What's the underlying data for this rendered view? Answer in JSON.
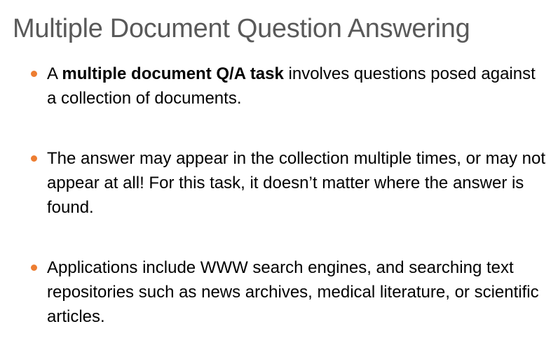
{
  "slide": {
    "title": "Multiple Document Question Answering",
    "accent_color": "#ED7D31",
    "bullets": [
      {
        "pre": "A ",
        "bold": "multiple document Q/A task",
        "post": " involves questions posed against a collection of documents."
      },
      {
        "text": "The answer may appear in the collection multiple times, or may not appear at all!  For this task, it doesn’t matter where the answer is found."
      },
      {
        "text": "Applications include WWW search engines, and searching text repositories such as news archives, medical literature, or scientific articles."
      }
    ]
  }
}
